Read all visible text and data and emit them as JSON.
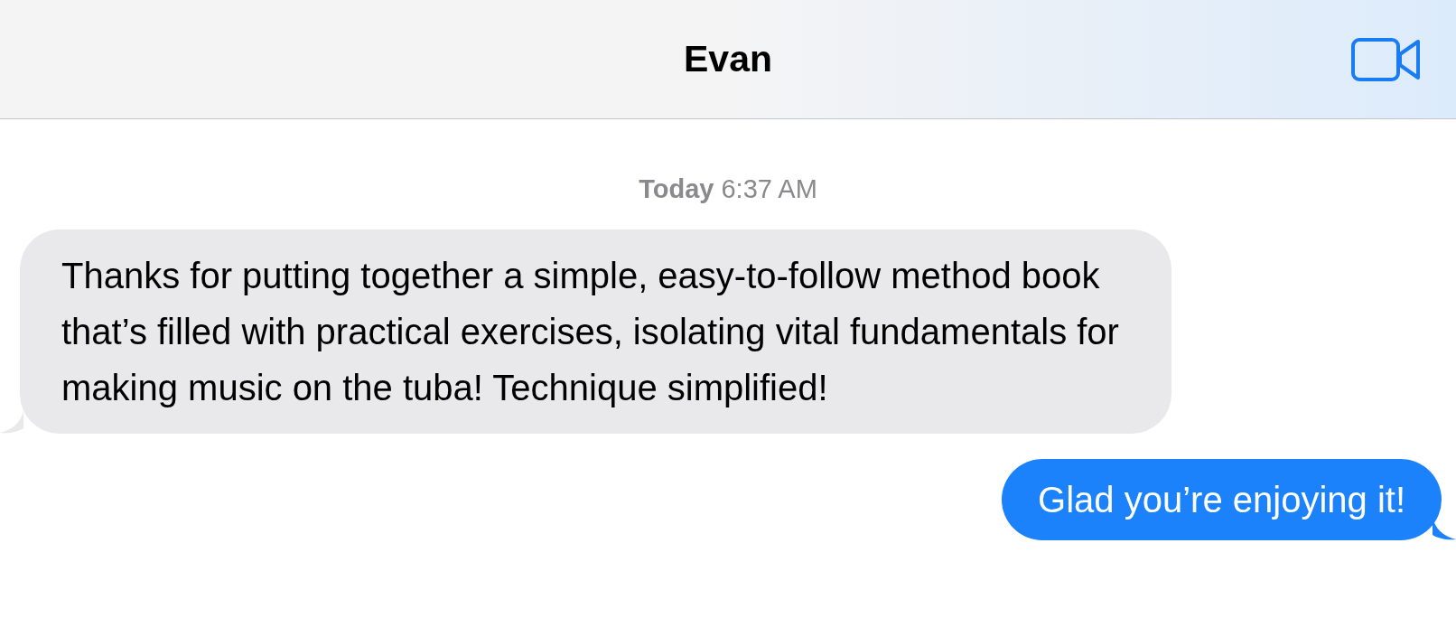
{
  "header": {
    "title": "Evan"
  },
  "timestamp": {
    "day": "Today",
    "time": "6:37 AM"
  },
  "messages": [
    {
      "kind": "incoming",
      "text": "Thanks for putting together a simple, easy-to-follow method book that’s filled with practical exercises, isolating vital fundamentals for making music on the tuba! Technique simplified!"
    },
    {
      "kind": "outgoing",
      "text": "Glad you’re enjoying it!"
    }
  ]
}
